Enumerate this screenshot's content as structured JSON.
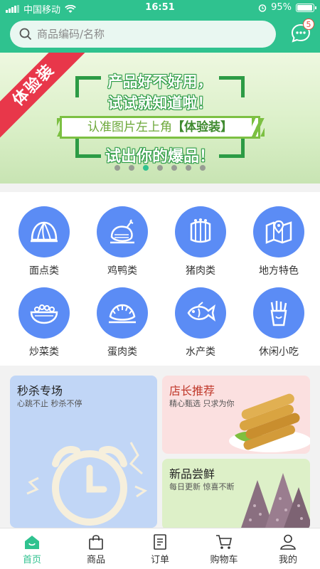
{
  "status_bar": {
    "carrier": "中国移动",
    "time": "16:51",
    "battery": "95%",
    "battery_level": 0.95
  },
  "search": {
    "placeholder": "商品编码/名称"
  },
  "messages": {
    "badge_count": "5"
  },
  "banner": {
    "ribbon": "体验装",
    "line1": "产品好不好用，",
    "line2": "试试就知道啦！",
    "line3_prefix": "认准图片左上角",
    "line3_highlight": "【体验装】",
    "line4": "试出你的爆品！",
    "dot_count": 7,
    "active_dot": 2
  },
  "categories": [
    {
      "label": "面点类",
      "icon": "steamed-bun-icon"
    },
    {
      "label": "鸡鸭类",
      "icon": "chicken-icon"
    },
    {
      "label": "猪肉类",
      "icon": "pork-ribs-icon"
    },
    {
      "label": "地方特色",
      "icon": "map-location-icon"
    },
    {
      "label": "炒菜类",
      "icon": "dish-bowl-icon"
    },
    {
      "label": "蛋肉类",
      "icon": "dumpling-icon"
    },
    {
      "label": "水产类",
      "icon": "fish-icon"
    },
    {
      "label": "休闲小吃",
      "icon": "fries-icon"
    }
  ],
  "promos": {
    "flash_sale": {
      "title": "秒杀专场",
      "subtitle": "心跳不止 秒杀不停",
      "color": "#c1d6f6"
    },
    "manager_pick": {
      "title": "店长推荐",
      "subtitle": "精心甄选 只求为你",
      "color": "#fbe0e0"
    },
    "new_arrivals": {
      "title": "新品尝鲜",
      "subtitle": "每日更新 惊喜不断",
      "color": "#ddf0c8"
    }
  },
  "tabs": [
    {
      "label": "首页",
      "icon": "home-icon",
      "active": true
    },
    {
      "label": "商品",
      "icon": "bag-icon",
      "active": false
    },
    {
      "label": "订单",
      "icon": "order-icon",
      "active": false
    },
    {
      "label": "购物车",
      "icon": "cart-icon",
      "active": false
    },
    {
      "label": "我的",
      "icon": "user-icon",
      "active": false
    }
  ],
  "colors": {
    "brand": "#2fc28f",
    "category": "#5b8cf5",
    "ribbon": "#e8374a"
  }
}
